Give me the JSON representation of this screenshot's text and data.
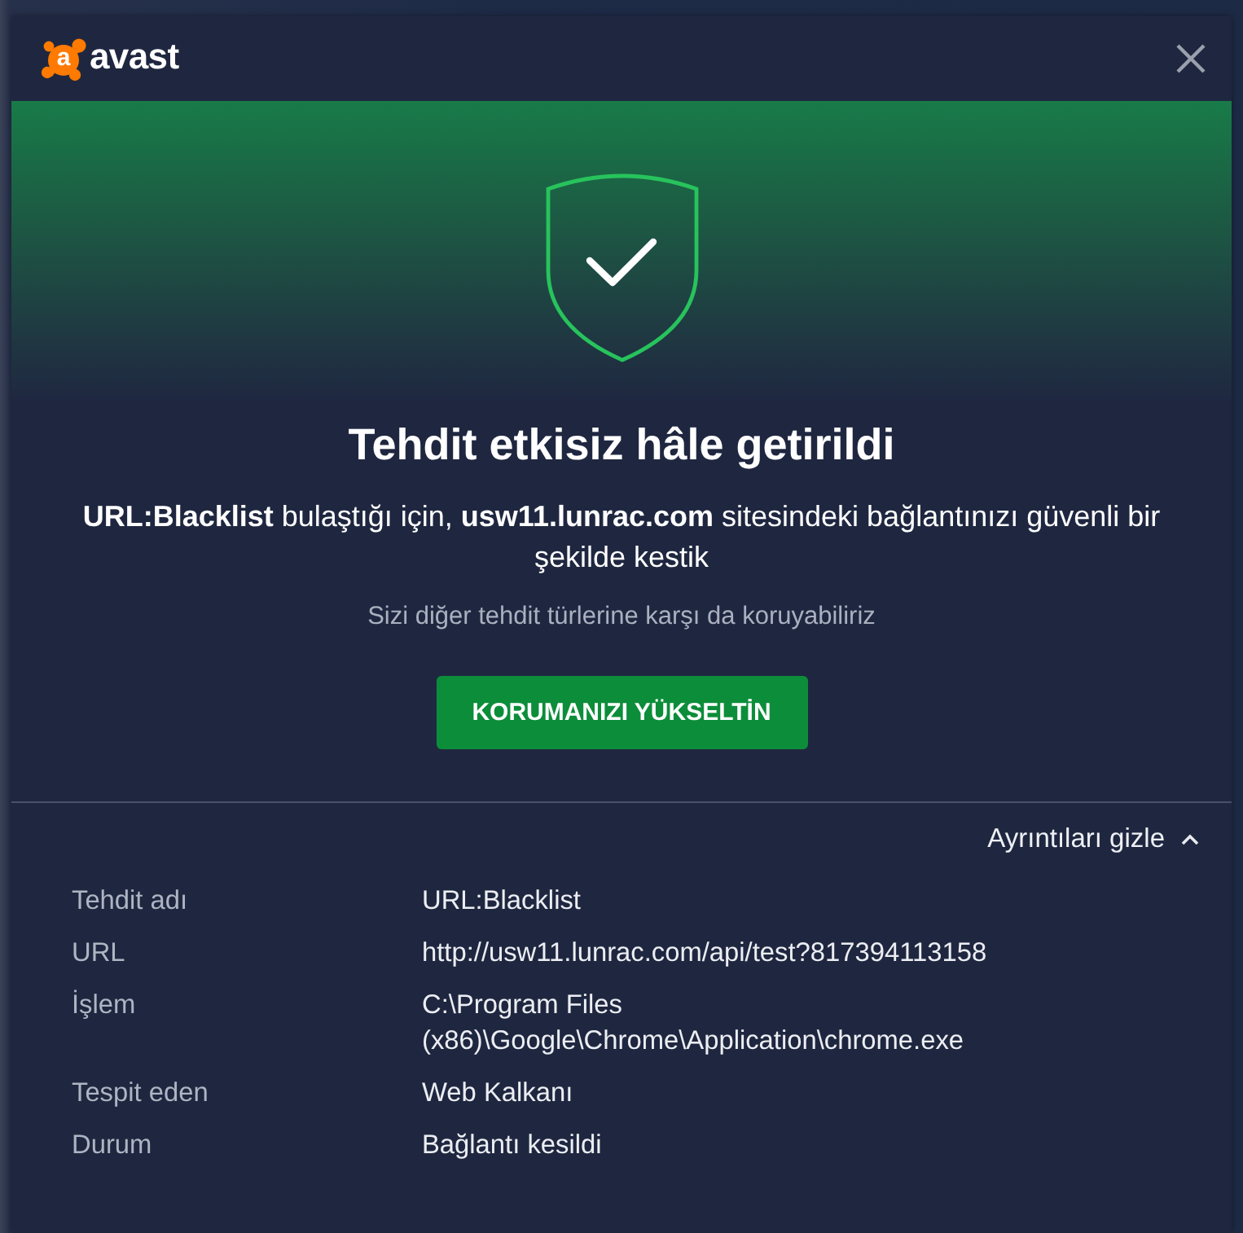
{
  "window": {
    "logo": {
      "mark": "a",
      "wordmark": "avast"
    }
  },
  "alert": {
    "title": "Tehdit etkisiz hâle getirildi",
    "message": "**URL:Blacklist** bulaştığı için, **usw11.lunrac.com** sitesindeki bağlantınızı güvenli bir şekilde kestik",
    "subtitle": "Sizi diğer tehdit türlerine karşı da koruyabiliriz",
    "button": "KORUMANIZI YÜKSELTİN"
  },
  "details": {
    "toggle_label": "Ayrıntıları gizle",
    "expanded": true,
    "rows": [
      {
        "label": "Tehdit adı",
        "value": "URL:Blacklist"
      },
      {
        "label": "URL",
        "value": "http://usw11.lunrac.com/api/test?817394113158"
      },
      {
        "label": "İşlem",
        "value": "C:\\Program Files (x86)\\Google\\Chrome\\Application\\chrome.exe"
      },
      {
        "label": "Tespit eden",
        "value": "Web Kalkanı"
      },
      {
        "label": "Durum",
        "value": "Bağlantı kesildi"
      }
    ]
  }
}
